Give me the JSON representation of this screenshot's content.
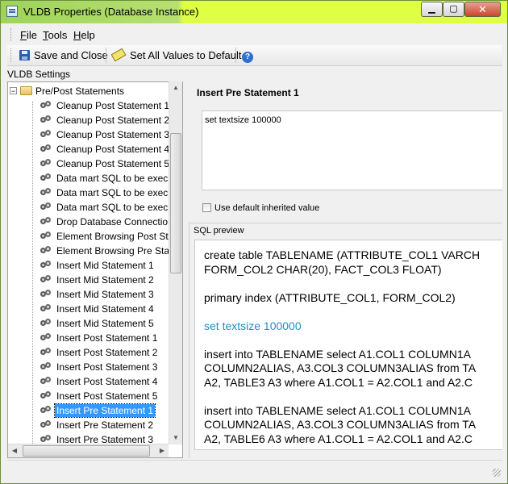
{
  "window": {
    "title": "VLDB Properties (Database Instance)",
    "min_glyph": "▁",
    "max_glyph": "▢",
    "close_glyph": "✕"
  },
  "menu": {
    "items": [
      {
        "key": "F",
        "rest": "ile"
      },
      {
        "key": "T",
        "rest": "ools"
      },
      {
        "key": "H",
        "rest": "elp"
      }
    ]
  },
  "toolbar": {
    "save_label": "Save and Close",
    "set_defaults_label": "Set All Values to Default",
    "help_glyph": "?"
  },
  "settings_label": "VLDB Settings",
  "tree": {
    "root_label": "Pre/Post Statements",
    "expander_glyph": "−",
    "items": [
      "Cleanup Post Statement 1",
      "Cleanup Post Statement 2",
      "Cleanup Post Statement 3",
      "Cleanup Post Statement 4",
      "Cleanup Post Statement 5",
      "Data mart SQL to be execu",
      "Data mart SQL to be execu",
      "Data mart SQL to be execu",
      "Drop Database Connection",
      "Element Browsing Post Stat",
      "Element Browsing Pre Stat",
      "Insert Mid Statement 1",
      "Insert Mid Statement 2",
      "Insert Mid Statement 3",
      "Insert Mid Statement 4",
      "Insert Mid Statement 5",
      "Insert Post Statement 1",
      "Insert Post Statement 2",
      "Insert Post Statement 3",
      "Insert Post Statement 4",
      "Insert Post Statement 5",
      "Insert Pre Statement 1",
      "Insert Pre Statement 2",
      "Insert Pre Statement 3"
    ],
    "selected_index": 21
  },
  "detail": {
    "title": "Insert Pre Statement 1",
    "value": "set textsize 100000",
    "use_default_label": "Use default inherited value",
    "preview_label": "SQL preview",
    "sql_lines": [
      {
        "text": "create table TABLENAME (ATTRIBUTE_COL1 VARCH",
        "highlight": false
      },
      {
        "text": "FORM_COL2 CHAR(20), FACT_COL3 FLOAT)",
        "highlight": false
      },
      {
        "text": "",
        "highlight": false
      },
      {
        "text": "primary index (ATTRIBUTE_COL1, FORM_COL2)",
        "highlight": false
      },
      {
        "text": "",
        "highlight": false
      },
      {
        "text": "set textsize 100000",
        "highlight": true
      },
      {
        "text": "",
        "highlight": false
      },
      {
        "text": "insert into TABLENAME select A1.COL1 COLUMN1A",
        "highlight": false
      },
      {
        "text": "COLUMN2ALIAS, A3.COL3 COLUMN3ALIAS from TA",
        "highlight": false
      },
      {
        "text": "A2, TABLE3 A3 where A1.COL1 = A2.COL1 and A2.C",
        "highlight": false
      },
      {
        "text": "",
        "highlight": false
      },
      {
        "text": "insert into TABLENAME select A1.COL1 COLUMN1A",
        "highlight": false
      },
      {
        "text": "COLUMN2ALIAS, A3.COL3 COLUMN3ALIAS from TA",
        "highlight": false
      },
      {
        "text": "A2, TABLE6 A3 where A1.COL1 = A2.COL1 and A2.C",
        "highlight": false
      }
    ]
  },
  "colors": {
    "selection": "#3399ff",
    "sql_highlight": "#1e8fc8",
    "titlebar_accent": "#dfff45"
  }
}
